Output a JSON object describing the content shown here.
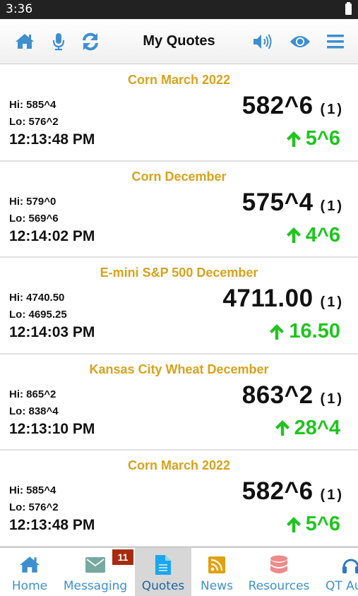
{
  "status_bar": {
    "time": "3:36",
    "battery_icon": "battery-full-icon"
  },
  "header": {
    "title": "My Quotes",
    "left_icons": [
      "home-icon",
      "microphone-icon",
      "refresh-icon"
    ],
    "right_icons": [
      "volume-icon",
      "eye-icon",
      "menu-icon"
    ]
  },
  "colors": {
    "accent_blue": "#3e8fd0",
    "title_gold": "#d7a21c",
    "up_green": "#1ec51e",
    "badge_red": "#a82b10"
  },
  "quotes": [
    {
      "name": "Corn March 2022",
      "hi": "Hi: 585^4",
      "lo": "Lo: 576^2",
      "time": "12:13:48 PM",
      "price": "582^6",
      "count": "(1)",
      "change": "5^6",
      "direction": "up"
    },
    {
      "name": "Corn December",
      "hi": "Hi: 579^0",
      "lo": "Lo: 569^6",
      "time": "12:14:02 PM",
      "price": "575^4",
      "count": "(1)",
      "change": "4^6",
      "direction": "up"
    },
    {
      "name": "E-mini S&P 500 December",
      "hi": "Hi: 4740.50",
      "lo": "Lo: 4695.25",
      "time": "12:14:03 PM",
      "price": "4711.00",
      "count": "(1)",
      "change": "16.50",
      "direction": "up"
    },
    {
      "name": "Kansas City Wheat December",
      "hi": "Hi: 865^2",
      "lo": "Lo: 838^4",
      "time": "12:13:10 PM",
      "price": "863^2",
      "count": "(1)",
      "change": "28^4",
      "direction": "up"
    },
    {
      "name": "Corn March 2022",
      "hi": "Hi: 585^4",
      "lo": "Lo: 576^2",
      "time": "12:13:48 PM",
      "price": "582^6",
      "count": "(1)",
      "change": "5^6",
      "direction": "up"
    }
  ],
  "bottom_nav": {
    "items": [
      {
        "label": "Home",
        "icon": "home-icon"
      },
      {
        "label": "Messaging",
        "icon": "envelope-icon",
        "badge": "11"
      },
      {
        "label": "Quotes",
        "icon": "document-icon",
        "active": true
      },
      {
        "label": "News",
        "icon": "rss-icon"
      },
      {
        "label": "Resources",
        "icon": "database-icon"
      },
      {
        "label": "QT Au",
        "icon": "headphones-icon"
      }
    ]
  }
}
